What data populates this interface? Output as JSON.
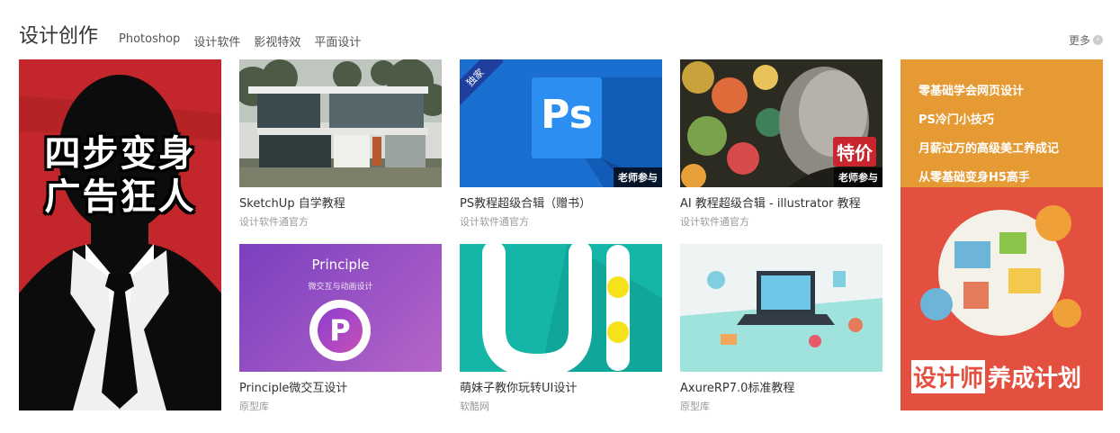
{
  "header": {
    "title": "设计创作",
    "nav": [
      "Photoshop",
      "设计软件",
      "影视特效",
      "平面设计"
    ],
    "more": "更多"
  },
  "feature": {
    "text_line1": "四步变身",
    "text_line2": "广告狂人"
  },
  "cards": [
    {
      "title": "SketchUp 自学教程",
      "sub": "设计软件通官方"
    },
    {
      "title": "PS教程超级合辑（赠书）",
      "sub": "设计软件通官方",
      "corner": "独家",
      "badge": "老师参与",
      "icon_text": "Ps"
    },
    {
      "title": "AI 教程超级合辑 - illustrator 教程",
      "sub": "设计软件通官方",
      "badge": "老师参与",
      "tag": "特价"
    },
    {
      "title": "Principle微交互设计",
      "sub": "原型库",
      "img_title": "Principle",
      "img_sub": "微交互与动画设计"
    },
    {
      "title": "萌妹子教你玩转UI设计",
      "sub": "软酷网"
    },
    {
      "title": "AxureRP7.0标准教程",
      "sub": "原型库"
    }
  ],
  "right": {
    "links": [
      "零基础学会网页设计",
      "PS冷门小技巧",
      "月薪过万的高级美工养成记",
      "从零基础变身H5高手"
    ],
    "promo_part1": "设计师",
    "promo_part2": "养成计划"
  }
}
